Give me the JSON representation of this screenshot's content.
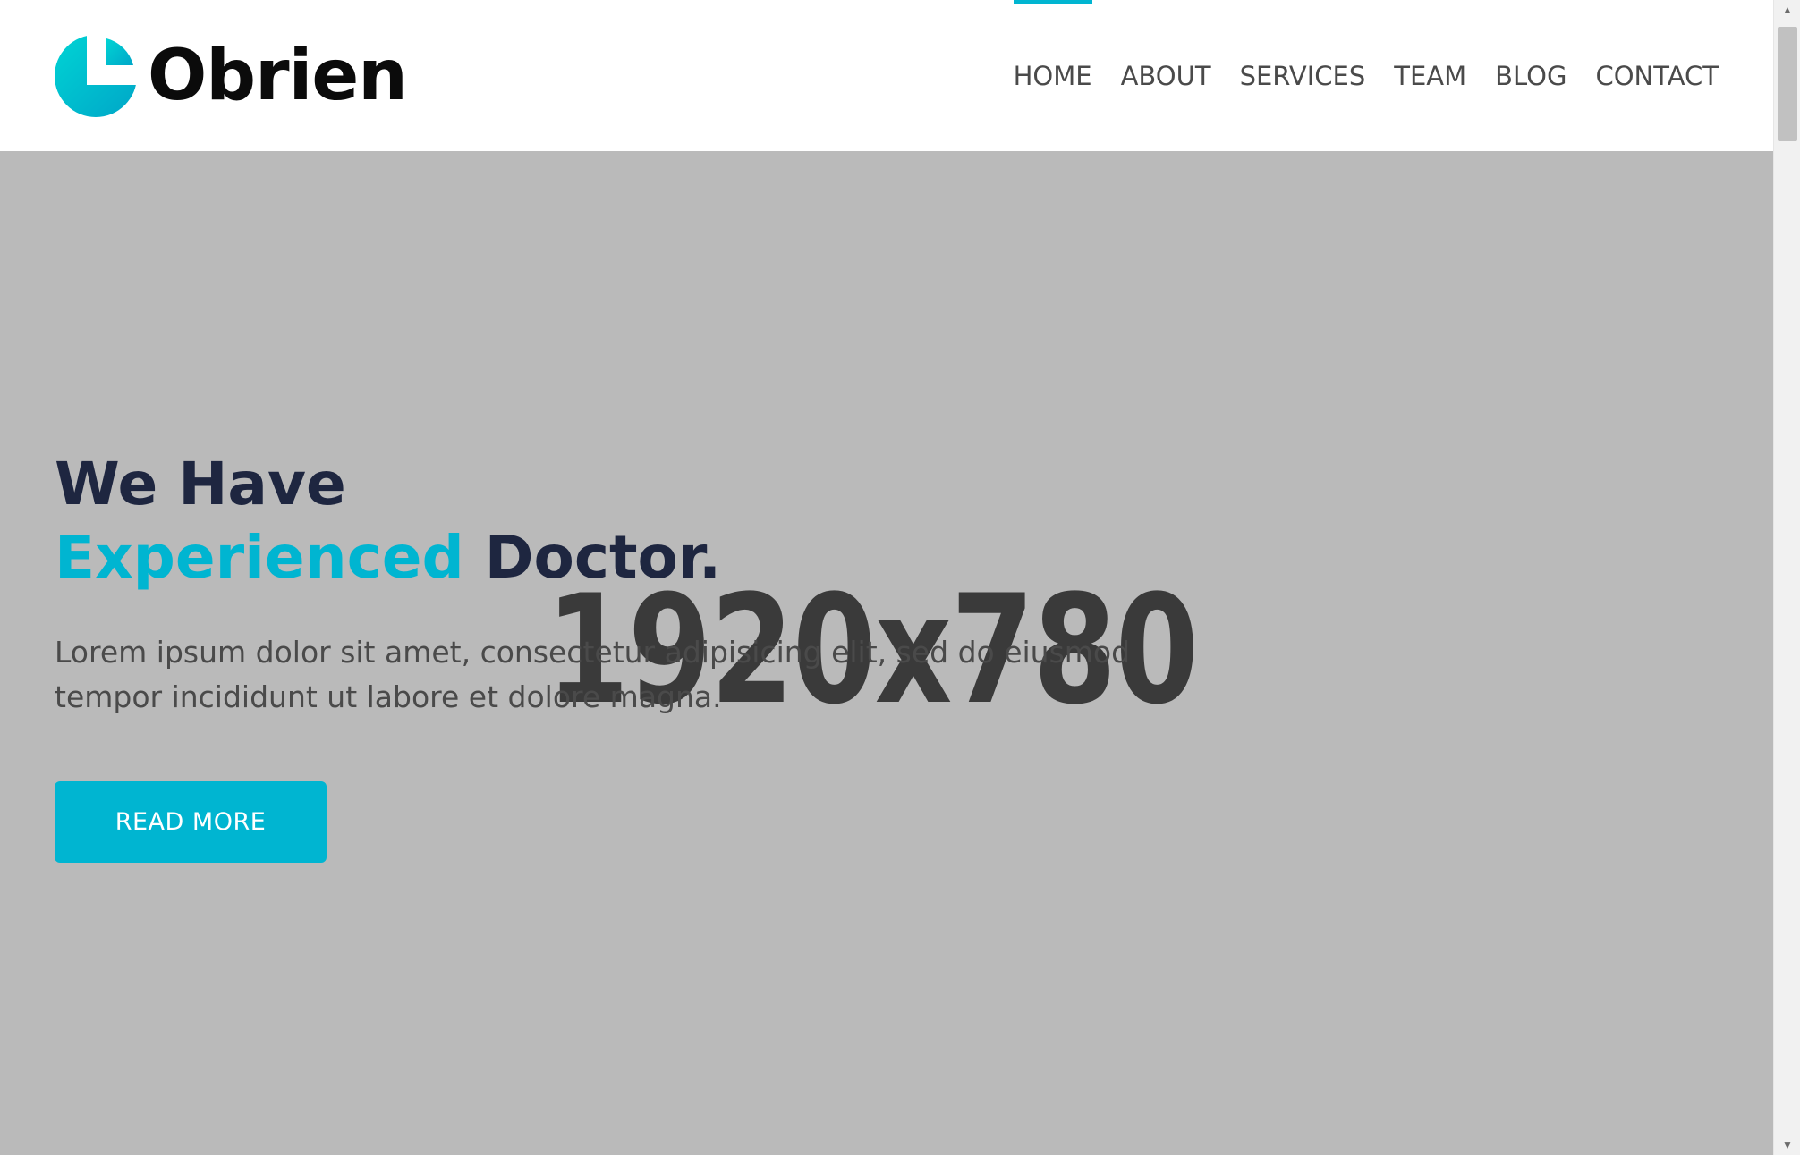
{
  "brand": {
    "name": "Obrien",
    "logo_icon": "medical-cross-icon",
    "accent_color": "#00b5d1",
    "dark_color": "#1e2640"
  },
  "nav": {
    "items": [
      {
        "label": "HOME",
        "active": true
      },
      {
        "label": "ABOUT",
        "active": false
      },
      {
        "label": "SERVICES",
        "active": false
      },
      {
        "label": "TEAM",
        "active": false
      },
      {
        "label": "BLOG",
        "active": false
      },
      {
        "label": "CONTACT",
        "active": false
      }
    ]
  },
  "hero": {
    "placeholder_label": "1920x780",
    "title_line1": "We Have",
    "title_accent": "Experienced",
    "title_rest": " Doctor.",
    "description": "Lorem ipsum dolor sit amet, consectetur adipisicing elit, sed do eiusmod tempor incididunt ut labore et dolore magna.",
    "cta_label": "READ MORE",
    "background_color": "#bababa"
  },
  "scrollbar": {
    "up_icon": "arrow-up-icon",
    "down_icon": "arrow-down-icon"
  }
}
